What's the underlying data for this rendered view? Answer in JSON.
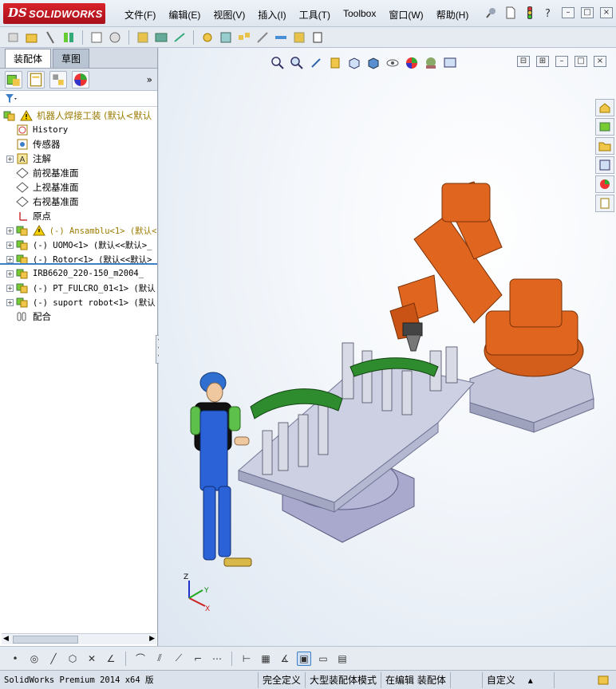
{
  "app": {
    "logo_ds": "DS",
    "logo_text": "SOLIDWORKS"
  },
  "menu": [
    "文件(F)",
    "编辑(E)",
    "视图(V)",
    "插入(I)",
    "工具(T)",
    "Toolbox",
    "窗口(W)",
    "帮助(H)"
  ],
  "feature_tabs": [
    "装配体",
    "草图"
  ],
  "tree": {
    "root": "机器人焊接工装  (默认<默认",
    "items": [
      {
        "label": "History",
        "icon": "history-icon",
        "mono": true,
        "expand": false
      },
      {
        "label": "传感器",
        "icon": "sensors-icon",
        "mono": false,
        "expand": false
      },
      {
        "label": "注解",
        "icon": "annotations-icon",
        "mono": false,
        "expand": true
      },
      {
        "label": "前视基准面",
        "icon": "plane-icon",
        "mono": false,
        "expand": false
      },
      {
        "label": "上视基准面",
        "icon": "plane-icon",
        "mono": false,
        "expand": false
      },
      {
        "label": "右视基准面",
        "icon": "plane-icon",
        "mono": false,
        "expand": false
      },
      {
        "label": "原点",
        "icon": "origin-icon",
        "mono": false,
        "expand": false
      },
      {
        "label": "(-) Ansamblu<1> (默认<默",
        "icon": "assembly-warning-icon",
        "mono": true,
        "expand": true,
        "yellow": true
      },
      {
        "label": "(-) UOMO<1> (默认<<默认>_",
        "icon": "assembly-icon",
        "mono": true,
        "expand": true
      },
      {
        "label": "(-) Rotor<1> (默认<<默认>_",
        "icon": "assembly-icon",
        "mono": true,
        "expand": true
      },
      {
        "label": "IRB6620_220-150_m2004_",
        "icon": "assembly-icon",
        "mono": true,
        "expand": true
      },
      {
        "label": "(-) PT_FULCRO_01<1> (默认",
        "icon": "assembly-icon",
        "mono": true,
        "expand": true
      },
      {
        "label": "(-) suport robot<1> (默认",
        "icon": "assembly-icon",
        "mono": true,
        "expand": true
      },
      {
        "label": "配合",
        "icon": "mates-icon",
        "mono": false,
        "expand": false
      }
    ]
  },
  "triad": {
    "x": "X",
    "y": "Y",
    "z": "Z"
  },
  "status": {
    "product": "SolidWorks Premium 2014 x64 版",
    "constraint": "完全定义",
    "mode": "大型装配体模式",
    "editing": "在编辑 装配体",
    "units": "自定义",
    "units_arrow": "▴"
  },
  "colors": {
    "robot": "#e0661f",
    "fixture_green": "#2e8b2e",
    "plate": "#c6c8dc",
    "accent_blue": "#3d7fc7"
  }
}
